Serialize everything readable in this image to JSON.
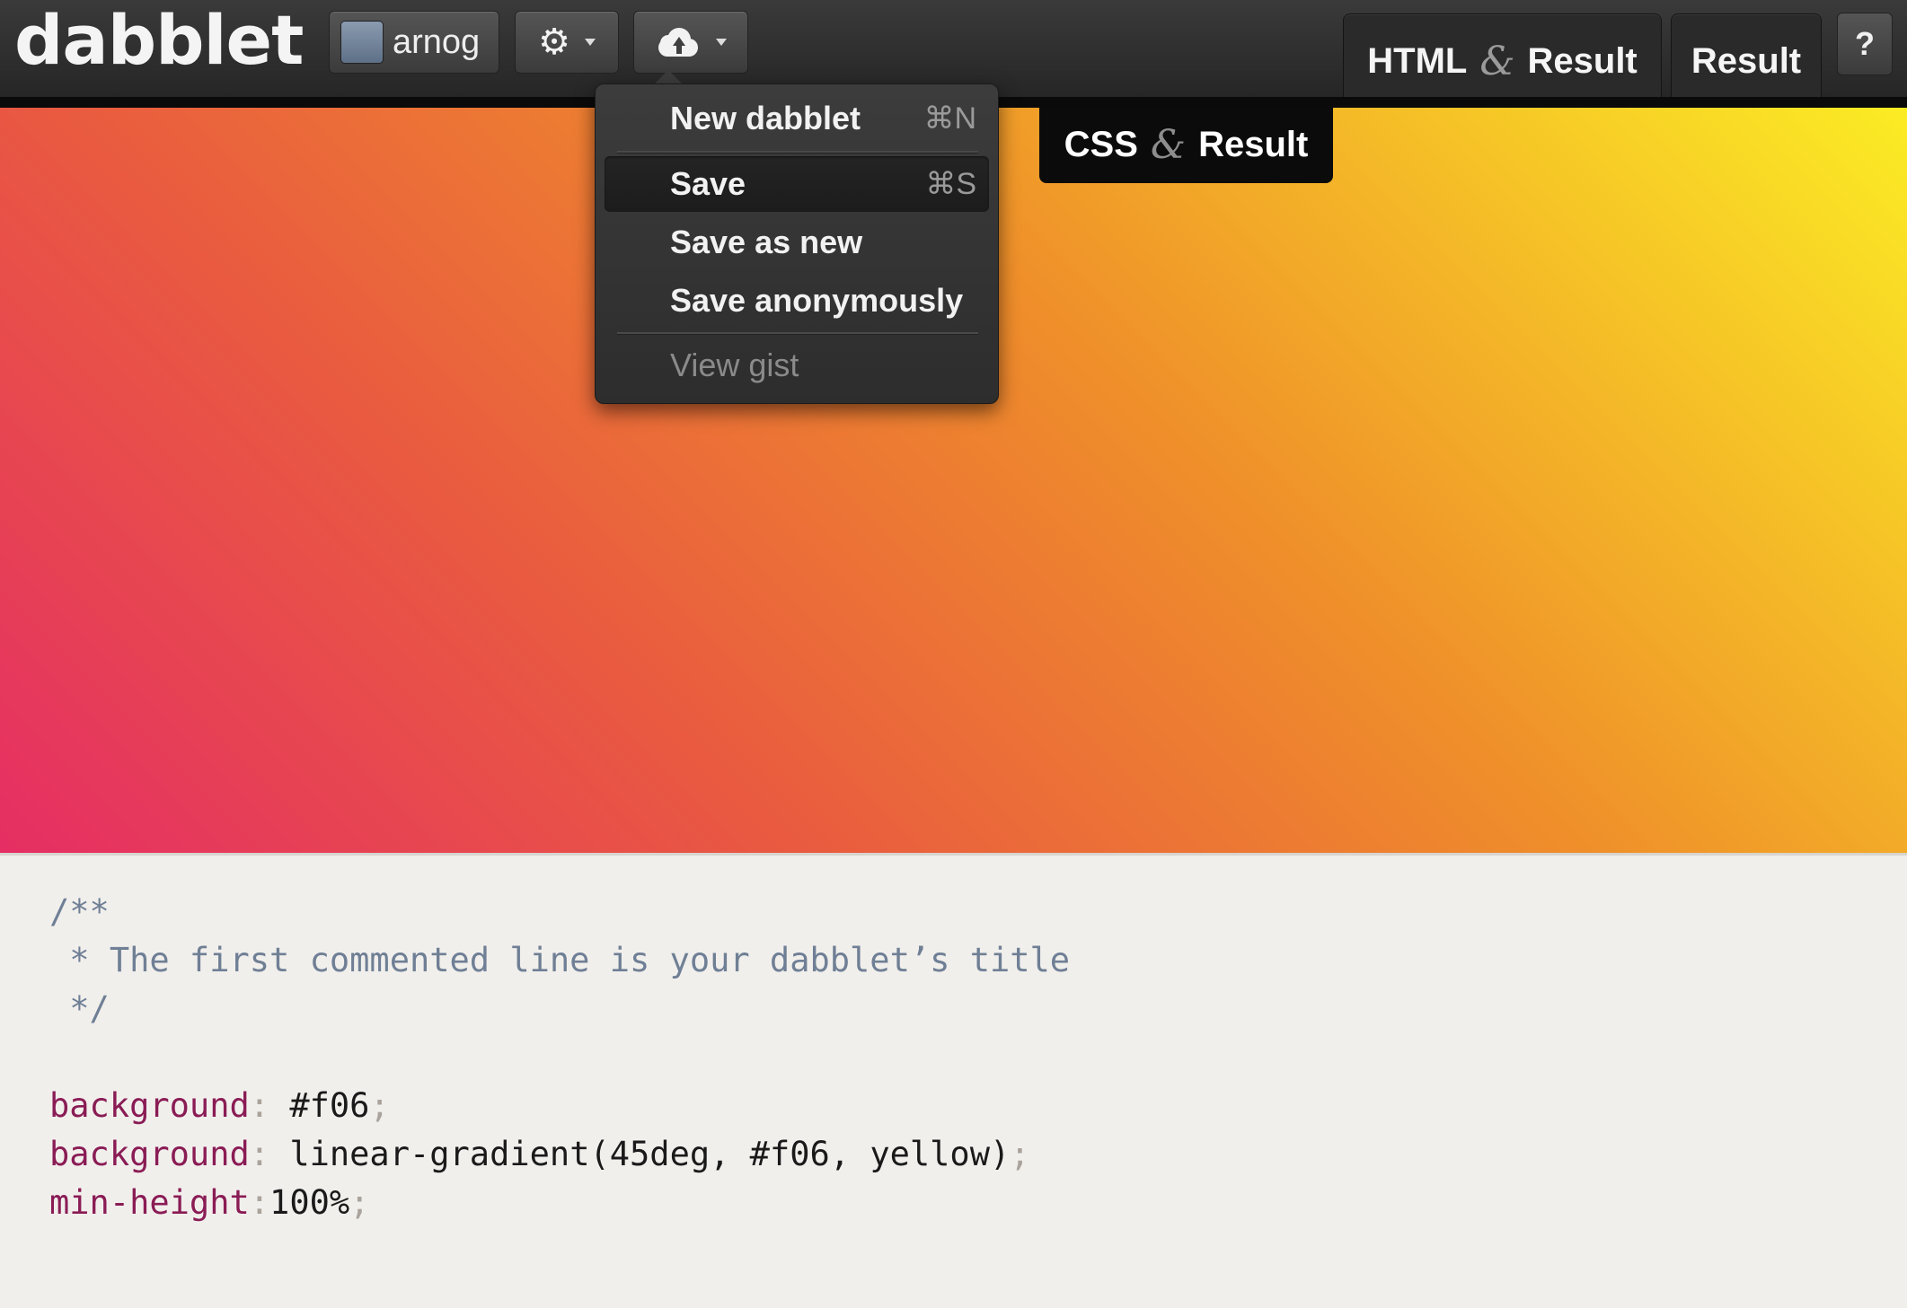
{
  "app": {
    "logo": "dabblet"
  },
  "toolbar": {
    "user_name": "arnog",
    "gear_glyph": "⚙",
    "help_label": "?"
  },
  "tabs": [
    {
      "label_left": "HTML",
      "amp": "&",
      "label_right": "Result"
    },
    {
      "label": "Result"
    }
  ],
  "result_tab": {
    "label_left": "CSS",
    "amp": "&",
    "label_right": "Result"
  },
  "result_background": {
    "angle": "45deg",
    "from": "#f06",
    "to": "yellow"
  },
  "menu": {
    "items": [
      {
        "label": "New dabblet",
        "shortcut": "⌘N"
      },
      {
        "label": "Save",
        "shortcut": "⌘S",
        "active": true
      },
      {
        "label": "Save as new",
        "shortcut": ""
      },
      {
        "label": "Save anonymously",
        "shortcut": ""
      },
      {
        "label": "View gist",
        "shortcut": "",
        "disabled": true
      }
    ]
  },
  "editor": {
    "comment_open": "/**",
    "comment_body": " * The first commented line is your dabblet’s title",
    "comment_close": " */",
    "declarations": [
      {
        "prop": "background",
        "colon": ": ",
        "value": "#f06",
        "semi": ";"
      },
      {
        "prop": "background",
        "colon": ": ",
        "value": "linear-gradient(45deg, #f06, yellow)",
        "semi": ";"
      },
      {
        "prop": "min-height",
        "colon": ":",
        "value": "100%",
        "semi": ";"
      }
    ]
  },
  "icons": {
    "user_avatar": "github-avatar-icon",
    "settings": "gear-icon",
    "cloud": "cloud-upload-icon",
    "caret": "caret-down-icon"
  }
}
